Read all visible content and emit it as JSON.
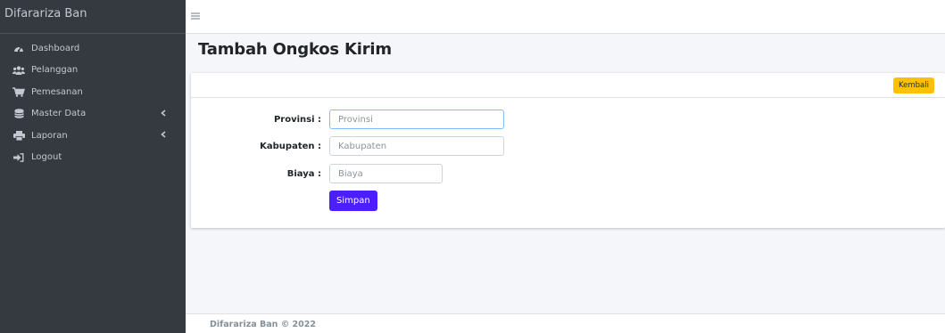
{
  "brand": {
    "name": "Difarariza Ban"
  },
  "sidebar": {
    "items": [
      {
        "label": "Dashboard",
        "icon": "dashboard-icon",
        "has_submenu": false
      },
      {
        "label": "Pelanggan",
        "icon": "users-icon",
        "has_submenu": false
      },
      {
        "label": "Pemesanan",
        "icon": "cart-icon",
        "has_submenu": false
      },
      {
        "label": "Master Data",
        "icon": "database-icon",
        "has_submenu": true
      },
      {
        "label": "Laporan",
        "icon": "print-icon",
        "has_submenu": true
      },
      {
        "label": "Logout",
        "icon": "logout-icon",
        "has_submenu": false
      }
    ]
  },
  "topbar": {
    "menu_icon": "hamburger-icon"
  },
  "page": {
    "title": "Tambah Ongkos Kirim"
  },
  "card": {
    "back_label": "Kembali",
    "form": {
      "provinsi": {
        "label": "Provinsi :",
        "placeholder": "Provinsi",
        "value": ""
      },
      "kabupaten": {
        "label": "Kabupaten :",
        "placeholder": "Kabupaten",
        "value": ""
      },
      "biaya": {
        "label": "Biaya :",
        "placeholder": "Biaya",
        "value": ""
      },
      "submit_label": "Simpan"
    }
  },
  "footer": {
    "text": "Difarariza Ban © 2022"
  },
  "colors": {
    "sidebar_bg": "#343a40",
    "sidebar_text": "#c2c7d0",
    "back_button": "#ffc107",
    "save_button": "#4c1fff",
    "content_bg": "#f4f6f9"
  }
}
